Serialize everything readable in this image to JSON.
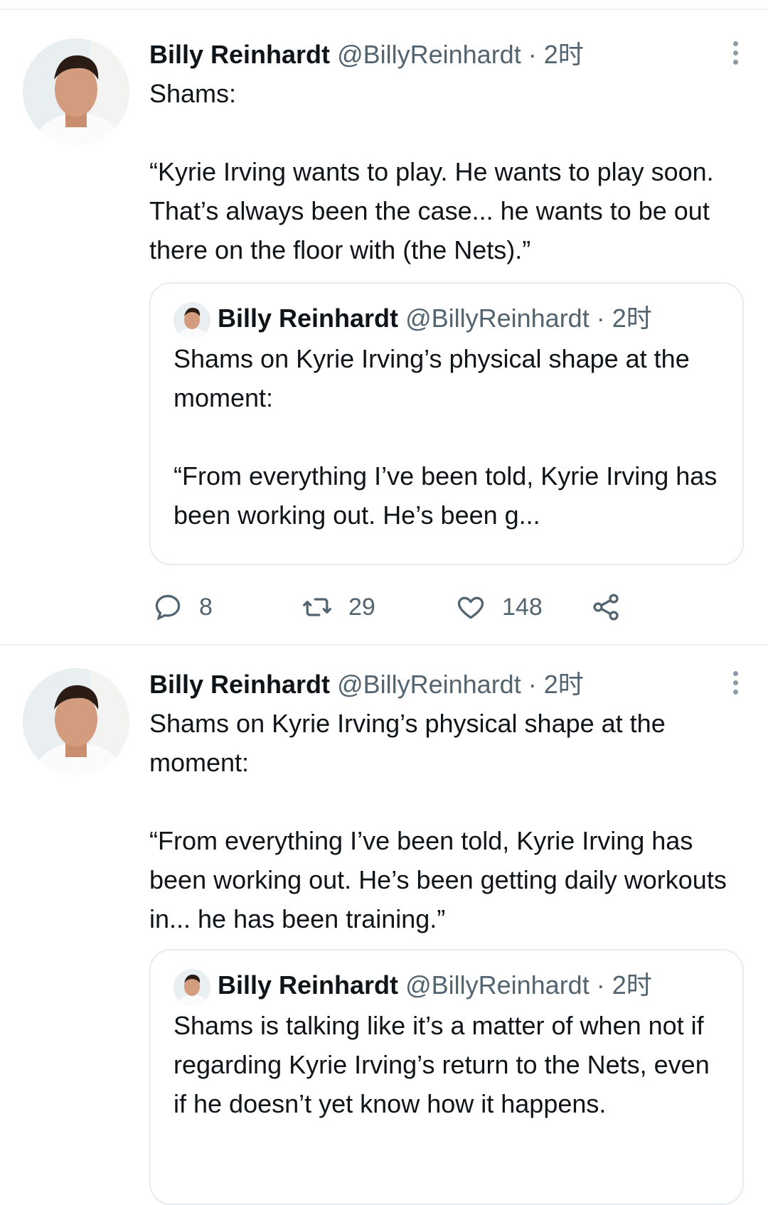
{
  "tweets": [
    {
      "name": "Billy Reinhardt",
      "handle": "@BillyReinhardt",
      "separator": "·",
      "time": "2时",
      "text": "Shams:\n\n“Kyrie Irving wants to play. He wants to play soon. That’s always been the case... he wants to be out there on the floor with (the Nets).”",
      "quote": {
        "name": "Billy Reinhardt",
        "handle": "@BillyReinhardt",
        "separator": "·",
        "time": "2时",
        "text": "Shams on Kyrie Irving’s physical shape at the moment:\n\n“From everything I’ve been told, Kyrie Irving has been working out. He’s been g..."
      },
      "actions": {
        "reply_count": "8",
        "retweet_count": "29",
        "like_count": "148"
      }
    },
    {
      "name": "Billy Reinhardt",
      "handle": "@BillyReinhardt",
      "separator": "·",
      "time": "2时",
      "text": "Shams on Kyrie Irving’s physical shape at the moment:\n\n“From everything I’ve been told, Kyrie Irving has been working out. He’s been getting daily workouts in... he has been training.”",
      "quote": {
        "name": "Billy Reinhardt",
        "handle": "@BillyReinhardt",
        "separator": "·",
        "time": "2时",
        "text": "Shams is talking like it’s a matter of when not if regarding Kyrie Irving’s return to the Nets, even if he doesn’t yet know how it happens."
      }
    }
  ],
  "icons": {
    "reply": "reply-icon",
    "retweet": "retweet-icon",
    "like": "heart-icon",
    "share": "share-icon",
    "more": "more-vertical-icon"
  },
  "colors": {
    "text": "#0f1419",
    "secondary": "#536471",
    "border": "#e6ecf0"
  }
}
